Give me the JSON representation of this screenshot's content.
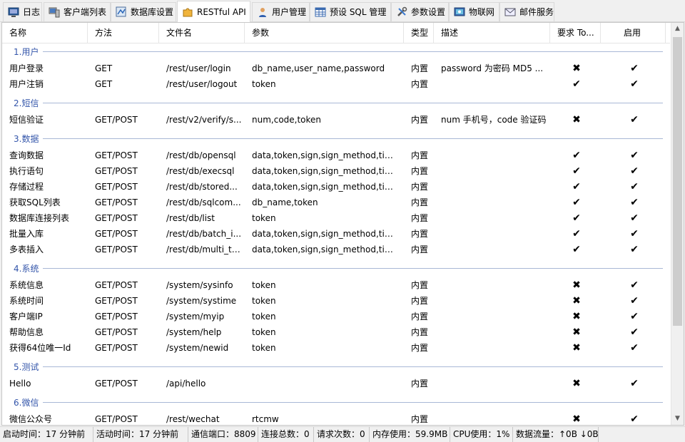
{
  "tabs": [
    {
      "label": "日志",
      "icon": "monitor-icon",
      "active": false
    },
    {
      "label": "客户端列表",
      "icon": "computer-icon",
      "active": false
    },
    {
      "label": "数据库设置",
      "icon": "database-settings-icon",
      "active": false
    },
    {
      "label": "RESTful API",
      "icon": "puzzle-icon",
      "active": true
    },
    {
      "label": "用户管理",
      "icon": "user-icon",
      "active": false
    },
    {
      "label": "预设 SQL 管理",
      "icon": "table-icon",
      "active": false
    },
    {
      "label": "参数设置",
      "icon": "tools-icon",
      "active": false
    },
    {
      "label": "物联网",
      "icon": "iot-icon",
      "active": false
    },
    {
      "label": "邮件服务",
      "icon": "mail-icon",
      "active": false
    }
  ],
  "columns": {
    "name": "名称",
    "method": "方法",
    "file": "文件名",
    "params": "参数",
    "type": "类型",
    "desc": "描述",
    "token": "要求 To...",
    "enabled": "启用"
  },
  "groups": [
    {
      "title": "1.用户",
      "rows": [
        {
          "name": "用户登录",
          "method": "GET",
          "file": "/rest/user/login",
          "params": "db_name,user_name,password",
          "type": "内置",
          "desc": "password 为密码 MD5 ...",
          "token": "cross",
          "enabled": "check"
        },
        {
          "name": "用户注销",
          "method": "GET",
          "file": "/rest/user/logout",
          "params": "token",
          "type": "内置",
          "desc": "",
          "token": "check",
          "enabled": "check"
        }
      ]
    },
    {
      "title": "2.短信",
      "rows": [
        {
          "name": "短信验证",
          "method": "GET/POST",
          "file": "/rest/v2/verify/s...",
          "params": "num,code,token",
          "type": "内置",
          "desc": "num 手机号，code 验证码",
          "token": "cross",
          "enabled": "check"
        }
      ]
    },
    {
      "title": "3.数据",
      "rows": [
        {
          "name": "查询数据",
          "method": "GET/POST",
          "file": "/rest/db/opensql",
          "params": "data,token,sign,sign_method,time...",
          "type": "内置",
          "desc": "",
          "token": "check",
          "enabled": "check"
        },
        {
          "name": "执行语句",
          "method": "GET/POST",
          "file": "/rest/db/execsql",
          "params": "data,token,sign,sign_method,time...",
          "type": "内置",
          "desc": "",
          "token": "check",
          "enabled": "check"
        },
        {
          "name": "存储过程",
          "method": "GET/POST",
          "file": "/rest/db/stored...",
          "params": "data,token,sign,sign_method,time...",
          "type": "内置",
          "desc": "",
          "token": "check",
          "enabled": "check"
        },
        {
          "name": "获取SQL列表",
          "method": "GET/POST",
          "file": "/rest/db/sqlcom...",
          "params": "db_name,token",
          "type": "内置",
          "desc": "",
          "token": "check",
          "enabled": "check"
        },
        {
          "name": "数据库连接列表",
          "method": "GET/POST",
          "file": "/rest/db/list",
          "params": "token",
          "type": "内置",
          "desc": "",
          "token": "check",
          "enabled": "check"
        },
        {
          "name": "批量入库",
          "method": "GET/POST",
          "file": "/rest/db/batch_i...",
          "params": "data,token,sign,sign_method,time...",
          "type": "内置",
          "desc": "",
          "token": "check",
          "enabled": "check"
        },
        {
          "name": "多表插入",
          "method": "GET/POST",
          "file": "/rest/db/multi_ta...",
          "params": "data,token,sign,sign_method,time...",
          "type": "内置",
          "desc": "",
          "token": "check",
          "enabled": "check"
        }
      ]
    },
    {
      "title": "4.系统",
      "rows": [
        {
          "name": "系统信息",
          "method": "GET/POST",
          "file": "/system/sysinfo",
          "params": "token",
          "type": "内置",
          "desc": "",
          "token": "cross",
          "enabled": "check"
        },
        {
          "name": "系统时间",
          "method": "GET/POST",
          "file": "/system/systime",
          "params": "token",
          "type": "内置",
          "desc": "",
          "token": "cross",
          "enabled": "check"
        },
        {
          "name": "客户端IP",
          "method": "GET/POST",
          "file": "/system/myip",
          "params": "token",
          "type": "内置",
          "desc": "",
          "token": "cross",
          "enabled": "check"
        },
        {
          "name": "帮助信息",
          "method": "GET/POST",
          "file": "/system/help",
          "params": "token",
          "type": "内置",
          "desc": "",
          "token": "cross",
          "enabled": "check"
        },
        {
          "name": "获得64位唯一Id",
          "method": "GET/POST",
          "file": "/system/newid",
          "params": "token",
          "type": "内置",
          "desc": "",
          "token": "cross",
          "enabled": "check"
        }
      ]
    },
    {
      "title": "5.测试",
      "rows": [
        {
          "name": "Hello",
          "method": "GET/POST",
          "file": "/api/hello",
          "params": "",
          "type": "内置",
          "desc": "",
          "token": "cross",
          "enabled": "check"
        }
      ]
    },
    {
      "title": "6.微信",
      "rows": [
        {
          "name": "微信公众号",
          "method": "GET/POST",
          "file": "/rest/wechat",
          "params": "rtcmw",
          "type": "内置",
          "desc": "",
          "token": "cross",
          "enabled": "check"
        }
      ]
    }
  ],
  "status": [
    "启动时间：17 分钟前",
    "活动时间：17 分钟前",
    "通信端口：8809",
    "连接总数：0",
    "请求次数：0",
    "内存使用：59.9MB",
    "CPU使用：1%",
    "数据流量：↑0B ↓0B"
  ],
  "colors": {
    "group_title": "#3355aa",
    "group_line": "#a9b8d6",
    "panel_bg": "#ffffff",
    "window_bg": "#f0f0f0"
  }
}
